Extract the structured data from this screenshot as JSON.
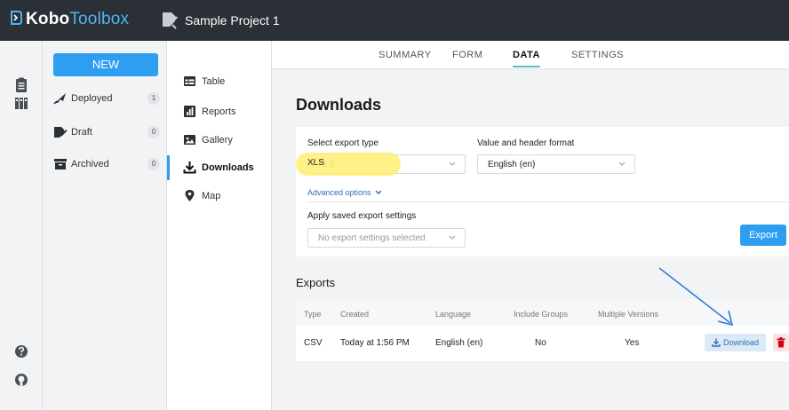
{
  "app": {
    "logo_kobo": "Kobo",
    "logo_toolbox": "Toolbox",
    "project_title": "Sample Project 1",
    "accent": "#2e9ef3",
    "topbar_bg": "#2b2f36"
  },
  "rail": {
    "icons": [
      "form-library-icon",
      "library-icon",
      "help-icon",
      "github-icon"
    ]
  },
  "projnav": {
    "new_label": "NEW",
    "items": [
      {
        "label": "Deployed",
        "count": "1",
        "icon": "rocket-icon"
      },
      {
        "label": "Draft",
        "count": "0",
        "icon": "draft-icon"
      },
      {
        "label": "Archived",
        "count": "0",
        "icon": "archive-icon"
      }
    ]
  },
  "subnav": {
    "items": [
      {
        "label": "Table",
        "icon": "table-icon"
      },
      {
        "label": "Reports",
        "icon": "reports-icon"
      },
      {
        "label": "Gallery",
        "icon": "gallery-icon"
      },
      {
        "label": "Downloads",
        "icon": "download-icon",
        "active": true
      },
      {
        "label": "Map",
        "icon": "map-pin-icon"
      }
    ]
  },
  "tabs": [
    {
      "label": "SUMMARY"
    },
    {
      "label": "FORM"
    },
    {
      "label": "DATA",
      "active": true
    },
    {
      "label": "SETTINGS"
    }
  ],
  "downloads": {
    "title": "Downloads",
    "export_type_label": "Select export type",
    "export_type_value": "XLS",
    "format_label": "Value and header format",
    "format_value": "English (en)",
    "advanced_label": "Advanced options",
    "saved_label": "Apply saved export settings",
    "saved_placeholder": "No export settings selected",
    "export_button": "Export",
    "highlight_color": "#fff07a"
  },
  "exports": {
    "title": "Exports",
    "columns": [
      "Type",
      "Created",
      "Language",
      "Include Groups",
      "Multiple Versions"
    ],
    "rows": [
      {
        "type": "CSV",
        "created": "Today at 1:56 PM",
        "language": "English (en)",
        "groups": "No",
        "versions": "Yes"
      }
    ],
    "download_label": "Download"
  }
}
